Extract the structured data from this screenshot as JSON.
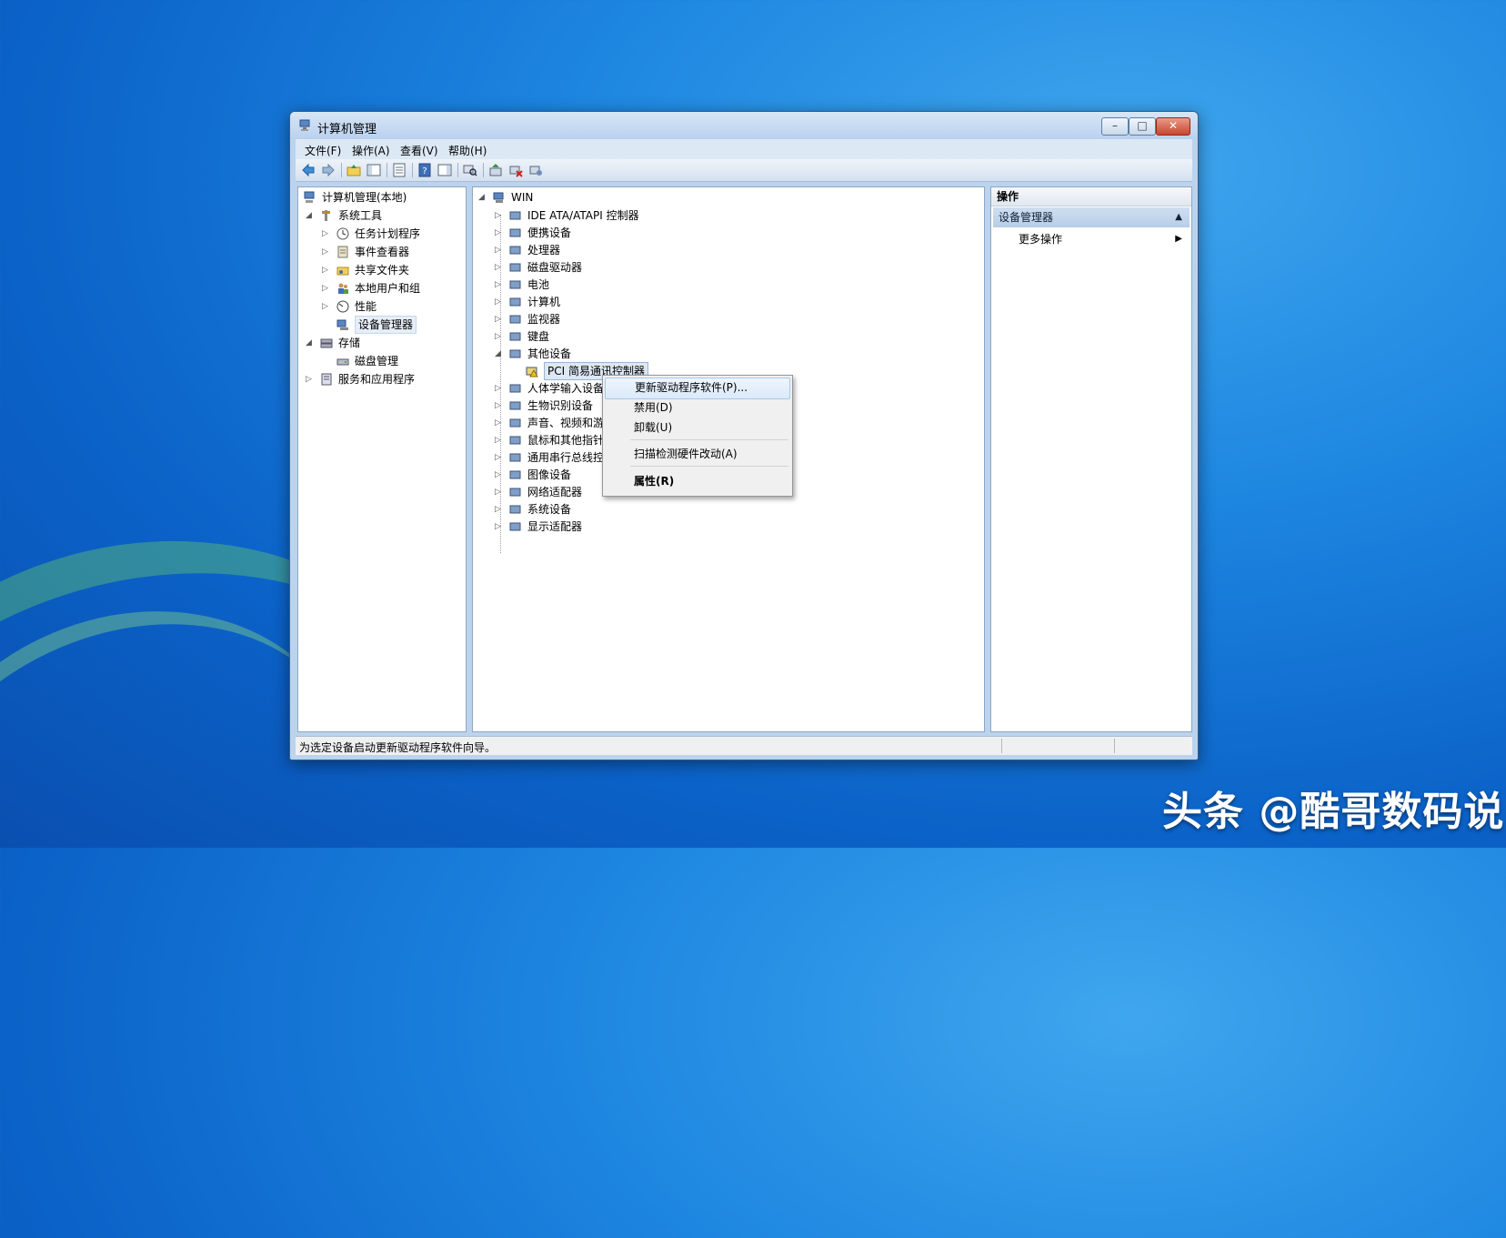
{
  "window": {
    "title": "计算机管理",
    "min_label": "–",
    "max_label": "□",
    "close_label": "✕"
  },
  "menubar": [
    "文件(F)",
    "操作(A)",
    "查看(V)",
    "帮助(H)"
  ],
  "toolbar_icons": [
    "back-icon",
    "forward-icon",
    "up-folder-icon",
    "show-hide-tree-icon",
    "properties-icon",
    "help-icon",
    "show-hide-action-icon",
    "scan-hardware-icon",
    "update-driver-icon",
    "disable-device-icon",
    "uninstall-device-icon"
  ],
  "left_tree": {
    "root": "计算机管理(本地)",
    "items": [
      {
        "label": "系统工具",
        "expander": "◢",
        "icon": "tools-icon"
      },
      {
        "label": "任务计划程序",
        "expander": "▷",
        "icon": "task-scheduler-icon"
      },
      {
        "label": "事件查看器",
        "expander": "▷",
        "icon": "event-viewer-icon"
      },
      {
        "label": "共享文件夹",
        "expander": "▷",
        "icon": "shared-folders-icon"
      },
      {
        "label": "本地用户和组",
        "expander": "▷",
        "icon": "users-groups-icon"
      },
      {
        "label": "性能",
        "expander": "▷",
        "icon": "performance-icon"
      },
      {
        "label": "设备管理器",
        "expander": "",
        "icon": "device-manager-icon"
      },
      {
        "label": "存储",
        "expander": "◢",
        "icon": "storage-icon"
      },
      {
        "label": "磁盘管理",
        "expander": "",
        "icon": "disk-management-icon"
      },
      {
        "label": "服务和应用程序",
        "expander": "▷",
        "icon": "services-icon"
      }
    ]
  },
  "device_tree": {
    "root": "WIN",
    "root_expander": "◢",
    "items": [
      {
        "label": "IDE ATA/ATAPI 控制器",
        "expander": "▷"
      },
      {
        "label": "便携设备",
        "expander": "▷"
      },
      {
        "label": "处理器",
        "expander": "▷"
      },
      {
        "label": "磁盘驱动器",
        "expander": "▷"
      },
      {
        "label": "电池",
        "expander": "▷"
      },
      {
        "label": "计算机",
        "expander": "▷"
      },
      {
        "label": "监视器",
        "expander": "▷"
      },
      {
        "label": "键盘",
        "expander": "▷"
      },
      {
        "label": "其他设备",
        "expander": "◢"
      },
      {
        "label": "PCI 简易通讯控制器",
        "expander": ""
      },
      {
        "label": "人体学输入设备",
        "expander": "▷"
      },
      {
        "label": "生物识别设备",
        "expander": "▷"
      },
      {
        "label": "声音、视频和游戏控制器",
        "expander": "▷"
      },
      {
        "label": "鼠标和其他指针设备",
        "expander": "▷"
      },
      {
        "label": "通用串行总线控制器",
        "expander": "▷"
      },
      {
        "label": "图像设备",
        "expander": "▷"
      },
      {
        "label": "网络适配器",
        "expander": "▷"
      },
      {
        "label": "系统设备",
        "expander": "▷"
      },
      {
        "label": "显示适配器",
        "expander": "▷"
      }
    ]
  },
  "actions": {
    "header": "操作",
    "section": "设备管理器",
    "section_arrow": "▲",
    "more": "更多操作",
    "more_arrow": "▶"
  },
  "context_menu": [
    "更新驱动程序软件(P)...",
    "禁用(D)",
    "卸载(U)",
    "扫描检测硬件改动(A)",
    "属性(R)"
  ],
  "status": "为选定设备启动更新驱动程序软件向导。",
  "watermark": "头条 @酷哥数码说",
  "colors": {
    "accent": "#1d86e0",
    "selection": "#dde8f6"
  }
}
